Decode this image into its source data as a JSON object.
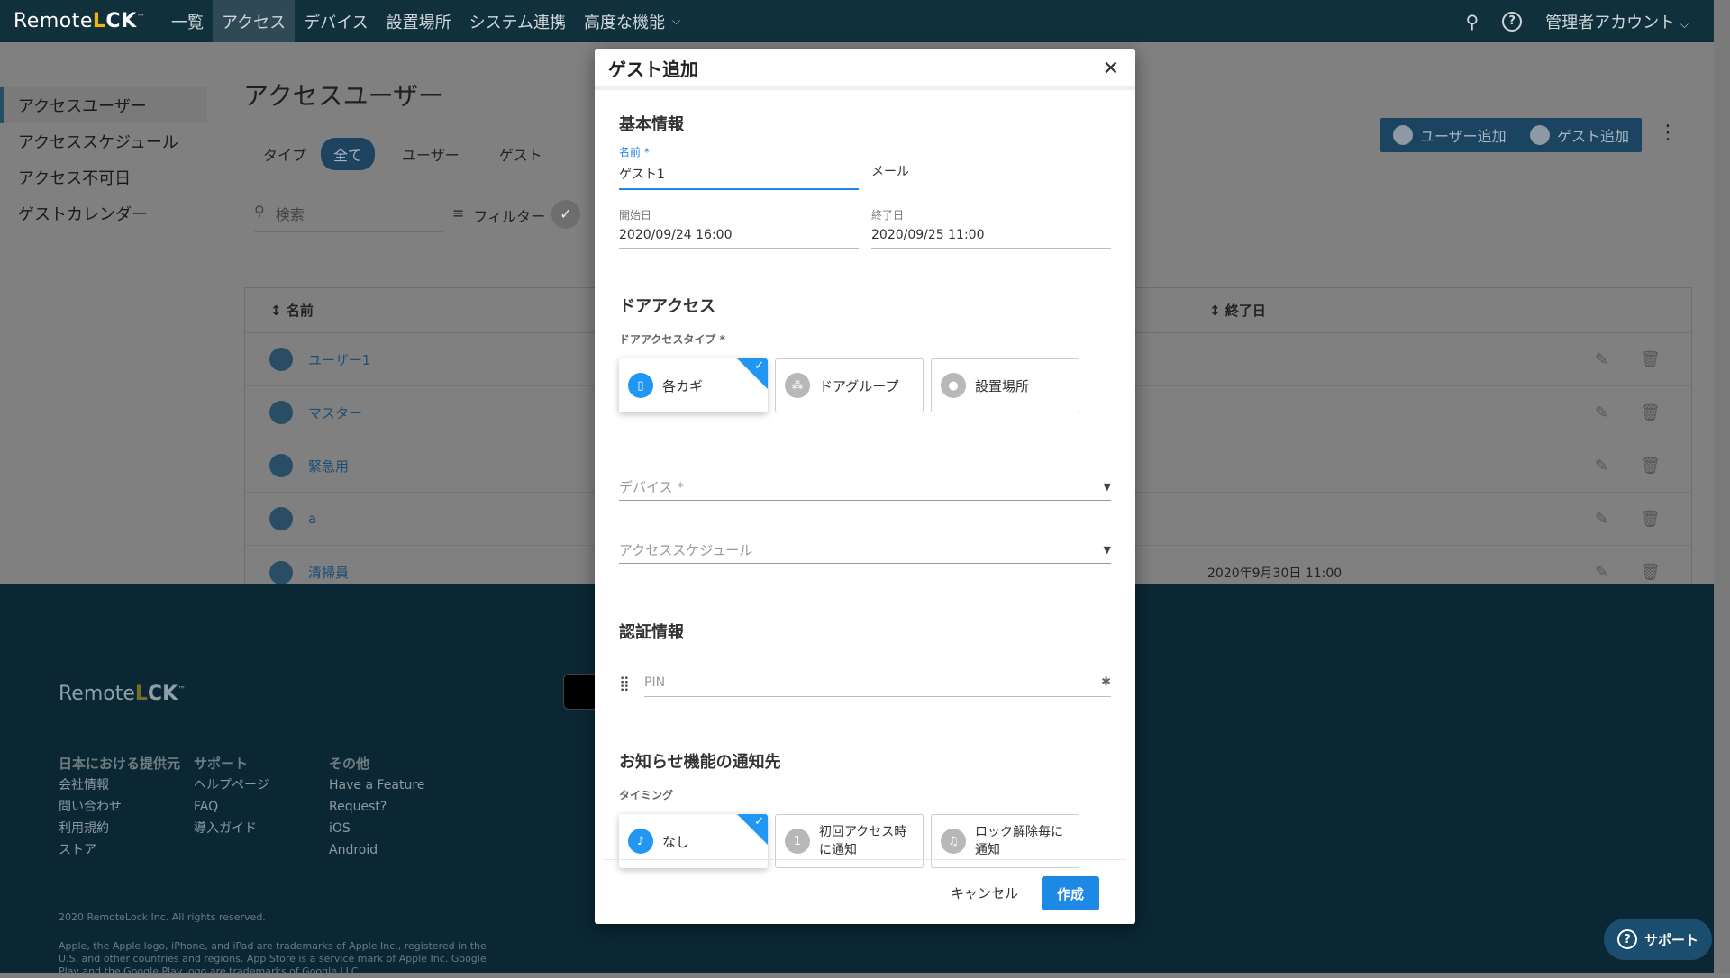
{
  "app": {
    "logo_left": "Remote",
    "logo_o": "L",
    "logo_right": "CK",
    "logo_tm": "™"
  },
  "nav": {
    "items": [
      "一覧",
      "アクセス",
      "デバイス",
      "設置場所",
      "システム連携",
      "高度な機能"
    ],
    "account": "管理者アカウント"
  },
  "sidebar": {
    "items": [
      "アクセスユーザー",
      "アクセススケジュール",
      "アクセス不可日",
      "ゲストカレンダー"
    ]
  },
  "page": {
    "title": "アクセスユーザー",
    "add_user": "ユーザー追加",
    "add_guest": "ゲスト追加"
  },
  "chips": {
    "label": "タイプ",
    "all": "全て",
    "user": "ユーザー",
    "guest": "ゲスト"
  },
  "search": {
    "placeholder": "検索",
    "filter": "フィルター"
  },
  "table": {
    "col_name": "名前",
    "col_end": "終了日",
    "rows": [
      {
        "name": "ユーザー1",
        "end": ""
      },
      {
        "name": "マスター",
        "end": ""
      },
      {
        "name": "緊急用",
        "end": ""
      },
      {
        "name": "a",
        "end": ""
      },
      {
        "name": "清掃員",
        "end": "2020年9月30日 11:00"
      }
    ]
  },
  "footer": {
    "col1_title": "日本における提供元",
    "col1_items": [
      "会社情報",
      "問い合わせ",
      "利用規約",
      "ストア"
    ],
    "col2_title": "サポート",
    "col2_items": [
      "ヘルプページ",
      "FAQ",
      "導入ガイド"
    ],
    "col3_title": "その他",
    "col3_items": [
      "Have a Feature",
      "Request?",
      "iOS",
      "Android"
    ],
    "copyright": "2020 RemoteLock Inc. All rights reserved.",
    "legal": "Apple, the Apple logo, iPhone, and iPad are trademarks of Apple Inc., registered in the U.S. and other countries and regions. App Store is a service mark of Apple Inc. Google Play and the Google Play logo are trademarks of Google LLC."
  },
  "support": {
    "label": "サポート"
  },
  "modal": {
    "title": "ゲスト追加",
    "sec_basic": "基本情報",
    "name_label": "名前 *",
    "name_value": "ゲスト1",
    "email_placeholder": "メール",
    "start_label": "開始日",
    "start_value": "2020/09/24 16:00",
    "end_label": "終了日",
    "end_value": "2020/09/25 11:00",
    "sec_door": "ドアアクセス",
    "door_type_label": "ドアアクセスタイプ *",
    "door_opts": [
      "各カギ",
      "ドアグループ",
      "設置場所"
    ],
    "device_placeholder": "デバイス *",
    "schedule_placeholder": "アクセススケジュール",
    "sec_auth": "認証情報",
    "pin_placeholder": "PIN",
    "sec_notify": "お知らせ機能の通知先",
    "timing_label": "タイミング",
    "notify_opts": [
      "なし",
      "初回アクセス時に通知",
      "ロック解除毎に通知"
    ],
    "cancel": "キャンセル",
    "create": "作成"
  }
}
